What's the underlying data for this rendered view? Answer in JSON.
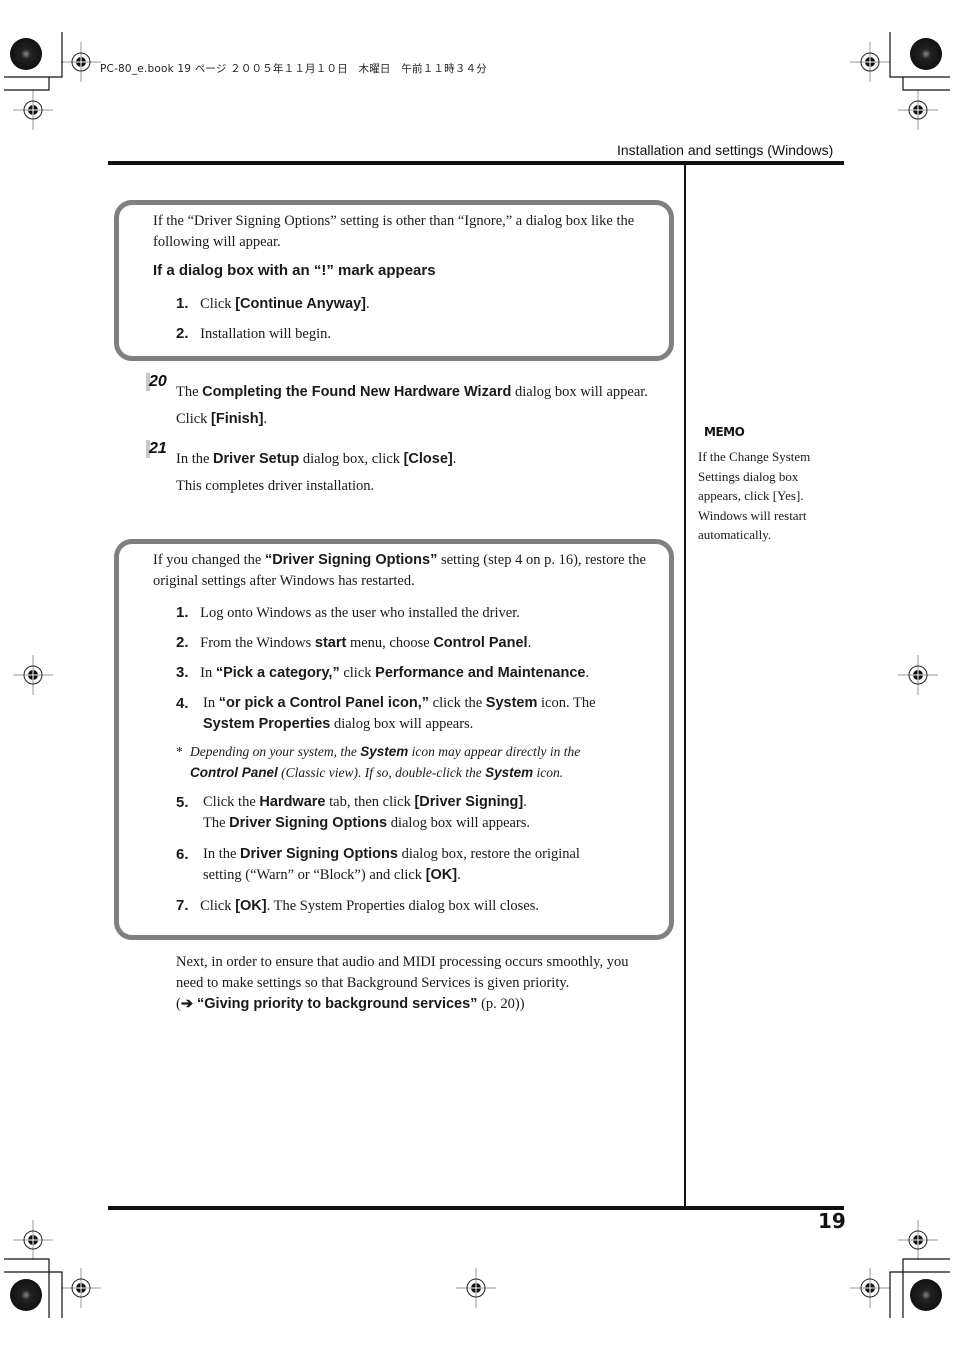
{
  "print_header": "PC-80_e.book  19 ページ  ２００５年１１月１０日　木曜日　午前１１時３４分",
  "running_head": "Installation and settings (Windows)",
  "page_number": "19",
  "box1": {
    "intro": "If the “Driver Signing Options” setting is other than “Ignore,” a dialog box like the following will appear.",
    "heading": "If a dialog box with an “!” mark appears",
    "steps": [
      {
        "num": "1.",
        "pre": "Click ",
        "bold": "[Continue Anyway]",
        "post": "."
      },
      {
        "num": "2.",
        "text": "Installation will begin."
      }
    ]
  },
  "step20": {
    "badge": "20",
    "line1_pre": "The ",
    "line1_bold": "Completing the Found New Hardware Wizard",
    "line1_post": " dialog box will appear.",
    "line2_pre": "Click ",
    "line2_bold": "[Finish]",
    "line2_post": "."
  },
  "step21": {
    "badge": "21",
    "line1_pre": "In the ",
    "line1_bold": "Driver Setup",
    "line1_mid": " dialog box, click ",
    "line1_bold2": "[Close]",
    "line1_post": ".",
    "line2": "This completes driver installation."
  },
  "memo": {
    "icon_label": "MEMO",
    "text": "If the Change System Settings dialog box appears, click [Yes]. Windows will restart automatically."
  },
  "box2": {
    "intro_pre": "If you changed the ",
    "intro_bold": "“Driver Signing Options”",
    "intro_post": " setting (step 4 on p. 16), restore the original settings after Windows has restarted.",
    "s1": {
      "num": "1.",
      "text": "Log onto Windows as the user who installed the driver."
    },
    "s2": {
      "num": "2.",
      "a": "From the Windows ",
      "b": "start",
      "c": " menu, choose ",
      "d": "Control Panel",
      "e": "."
    },
    "s3": {
      "num": "3.",
      "a": "In ",
      "b": "“Pick a category,”",
      "c": " click ",
      "d": "Performance and Maintenance",
      "e": "."
    },
    "s4": {
      "num": "4.",
      "a": "In ",
      "b": "“or pick a Control Panel icon,”",
      "c": " click the ",
      "d": "System",
      "e": " icon. The ",
      "f": "System Properties",
      "g": " dialog box will appears."
    },
    "note": {
      "star": "*",
      "a": "Depending on your system, the ",
      "b": "System",
      "c": " icon may appear directly in the ",
      "d": "Control Panel",
      "e": " (Classic view). If so, double-click the ",
      "f": "System",
      "g": " icon."
    },
    "s5": {
      "num": "5.",
      "a": "Click the ",
      "b": "Hardware",
      "c": " tab, then click ",
      "d": "[Driver Signing]",
      "e": ".",
      "f": "The ",
      "g": "Driver Signing Options",
      "h": " dialog box will appears."
    },
    "s6": {
      "num": "6.",
      "a": "In the ",
      "b": "Driver Signing Options",
      "c": " dialog box, restore the original setting (“Warn” or “Block”) and click ",
      "d": "[OK]",
      "e": "."
    },
    "s7": {
      "num": "7.",
      "a": "Click ",
      "b": "[OK]",
      "c": ". The System Properties dialog box will closes."
    }
  },
  "closing": {
    "text": "Next, in order to ensure that audio and MIDI processing occurs smoothly, you need to make settings so that Background Services is given priority.",
    "ref_open": "(",
    "ref_arrow": "➔",
    "ref_bold": " “Giving priority to background services”",
    "ref_post": " (p. 20))"
  }
}
